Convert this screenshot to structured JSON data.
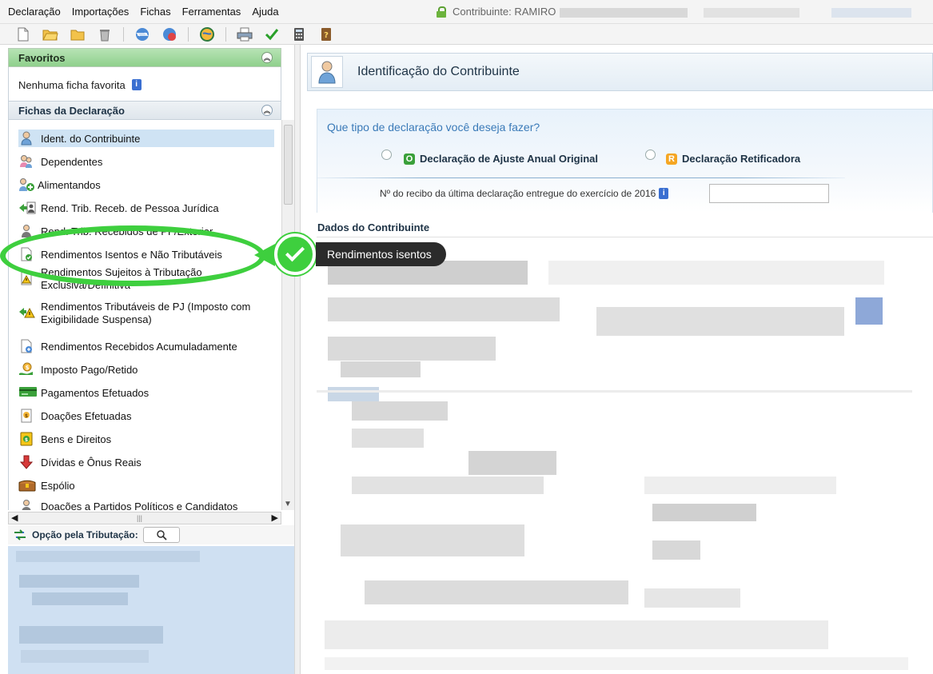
{
  "menu": [
    "Declaração",
    "Importações",
    "Fichas",
    "Ferramentas",
    "Ajuda"
  ],
  "contribuinte": "Contribuinte: RAMIRO",
  "favoritos": {
    "title": "Favoritos",
    "empty": "Nenhuma ficha favorita"
  },
  "fichas": {
    "title": "Fichas da Declaração",
    "items": [
      "Ident. do Contribuinte",
      "Dependentes",
      "Alimentandos",
      "Rend. Trib. Receb. de Pessoa Jurídica",
      "Rend. Trib. Recebidos de PF/Exterior",
      "Rendimentos Isentos e Não Tributáveis",
      "Rendimentos Sujeitos à Tributação",
      "Exclusiva/Definitiva",
      "Rendimentos Tributáveis de PJ (Imposto com",
      "Exigibilidade Suspensa)",
      "Rendimentos Recebidos Acumuladamente",
      "Imposto Pago/Retido",
      "Pagamentos Efetuados",
      "Doações Efetuadas",
      "Bens e Direitos",
      "Dívidas e Ônus Reais",
      "Espólio",
      "Doações a Partidos Políticos e Candidatos"
    ]
  },
  "opcao": {
    "label": "Opção pela Tributação:"
  },
  "main": {
    "title": "Identificação do Contribuinte",
    "question": "Que tipo de declaração você deseja fazer?",
    "option_original": "Declaração de Ajuste Anual Original",
    "option_retificadora": "Declaração Retificadora",
    "recibo_label": "Nº do recibo da última declaração entregue do exercício de 2016",
    "recibo_value": "",
    "dados_label": "Dados do Contribuinte"
  },
  "annotation": {
    "label": "Rendimentos isentos"
  },
  "colors": {
    "accent_green": "#3ecf3e",
    "header_blue": "#1e3346"
  }
}
